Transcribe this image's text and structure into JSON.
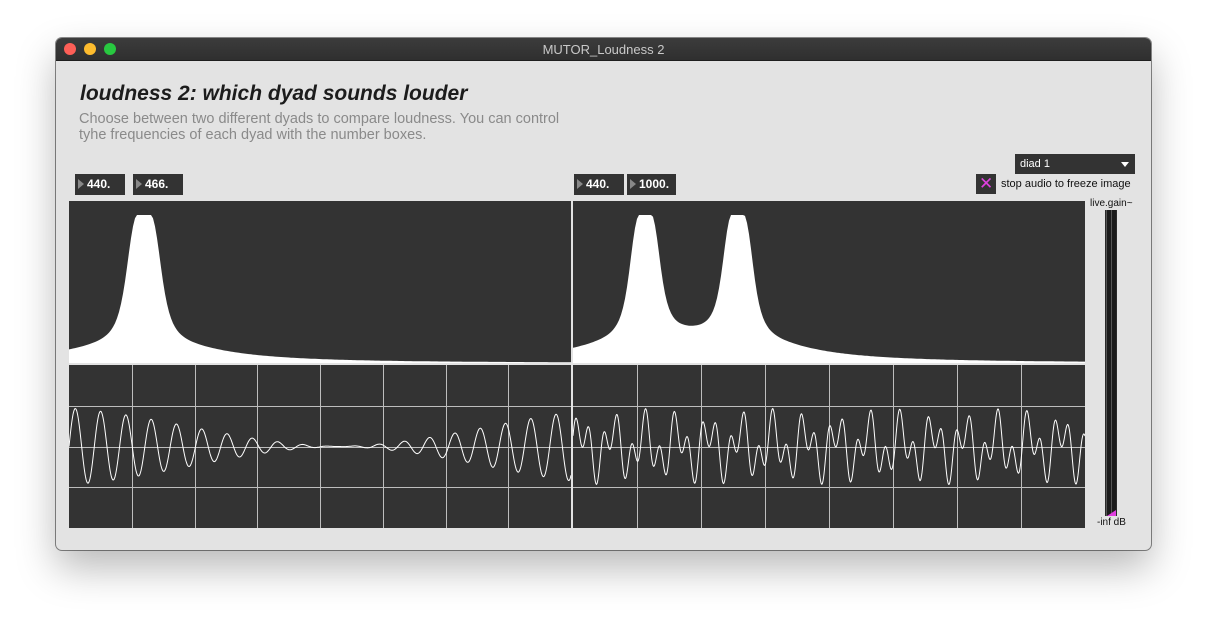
{
  "window": {
    "title": "MUTOR_Loudness 2"
  },
  "heading": "loudness 2: which dyad sounds louder",
  "description": {
    "line1": "Choose between two different dyads to compare loudness. You can control",
    "line2": "tyhe frequencies of each dyad with the number boxes."
  },
  "dyad1": {
    "freq1": "440.",
    "freq2": "466."
  },
  "dyad2": {
    "freq1": "440.",
    "freq2": "1000."
  },
  "menu": {
    "selected": "diad 1"
  },
  "freeze": {
    "label": "stop audio to freeze image",
    "checked": true
  },
  "gain": {
    "name": "live.gain~",
    "value": "-inf dB"
  },
  "colors": {
    "panel": "#333333",
    "trace": "#ffffff",
    "accent": "#e040e0",
    "window_bg": "#e3e3e3"
  }
}
